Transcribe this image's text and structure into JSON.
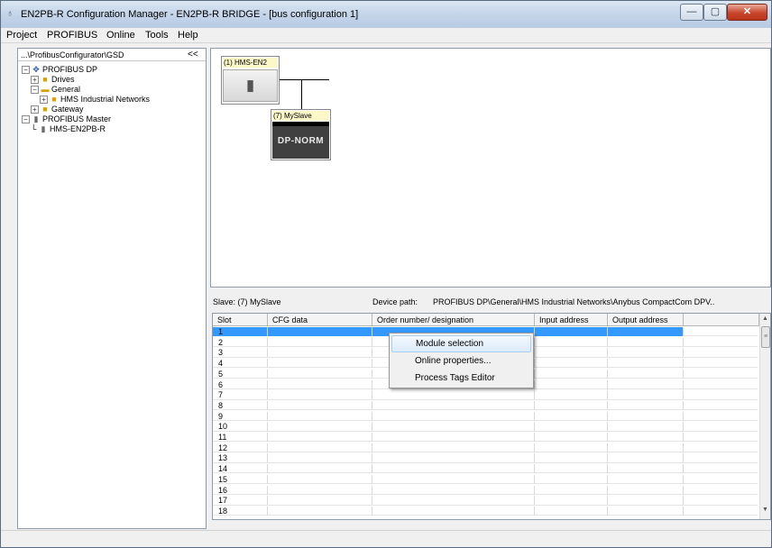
{
  "window": {
    "title": "EN2PB-R Configuration Manager - EN2PB-R BRIDGE - [bus configuration 1]",
    "minimize_glyph": "—",
    "maximize_glyph": "▢",
    "close_glyph": "✕"
  },
  "menu": [
    "Project",
    "PROFIBUS",
    "Online",
    "Tools",
    "Help"
  ],
  "left_panel": {
    "path": "...\\ProfibusConfigurator\\GSD",
    "collapse_label": "<<",
    "tree": [
      {
        "label": "PROFIBUS DP",
        "icon": "network-icon",
        "exp": "−"
      },
      {
        "label": "Drives",
        "icon": "folder-icon",
        "exp": "+"
      },
      {
        "label": "General",
        "icon": "folder-icon",
        "exp": "−"
      },
      {
        "label": "HMS Industrial Networks",
        "icon": "folder-icon",
        "exp": "+"
      },
      {
        "label": "Gateway",
        "icon": "folder-icon",
        "exp": "+"
      },
      {
        "label": "PROFIBUS Master",
        "icon": "device-icon",
        "exp": "−"
      },
      {
        "label": "HMS-EN2PB-R",
        "icon": "device-icon",
        "exp": ""
      }
    ]
  },
  "diagram": {
    "master_label": "(1) HMS-EN2",
    "slave_label": "(7) MySlave",
    "slave_text": "DP-NORM"
  },
  "slave_info": {
    "slave": "Slave:  (7) MySlave",
    "device_path_label": "Device path:",
    "device_path": "PROFIBUS DP\\General\\HMS Industrial Networks\\Anybus CompactCom DPV.."
  },
  "grid": {
    "columns": [
      "Slot",
      "CFG data",
      "Order number/ designation",
      "Input address",
      "Output address"
    ],
    "rows": [
      "1",
      "2",
      "3",
      "4",
      "5",
      "6",
      "7",
      "8",
      "9",
      "10",
      "11",
      "12",
      "13",
      "14",
      "15",
      "16",
      "17",
      "18"
    ],
    "selected_row": 1,
    "scroll_up": "▲",
    "scroll_down": "▼",
    "thumb_grip": "≡"
  },
  "context_menu": {
    "items": [
      "Module selection",
      "Online properties...",
      "Process Tags Editor"
    ],
    "highlighted": 0
  },
  "colors": {
    "selection": "#3399ff",
    "title_gradient": "#c6d6ea",
    "slave_dark": "#404040",
    "label_yellow": "#fcf8c8"
  }
}
